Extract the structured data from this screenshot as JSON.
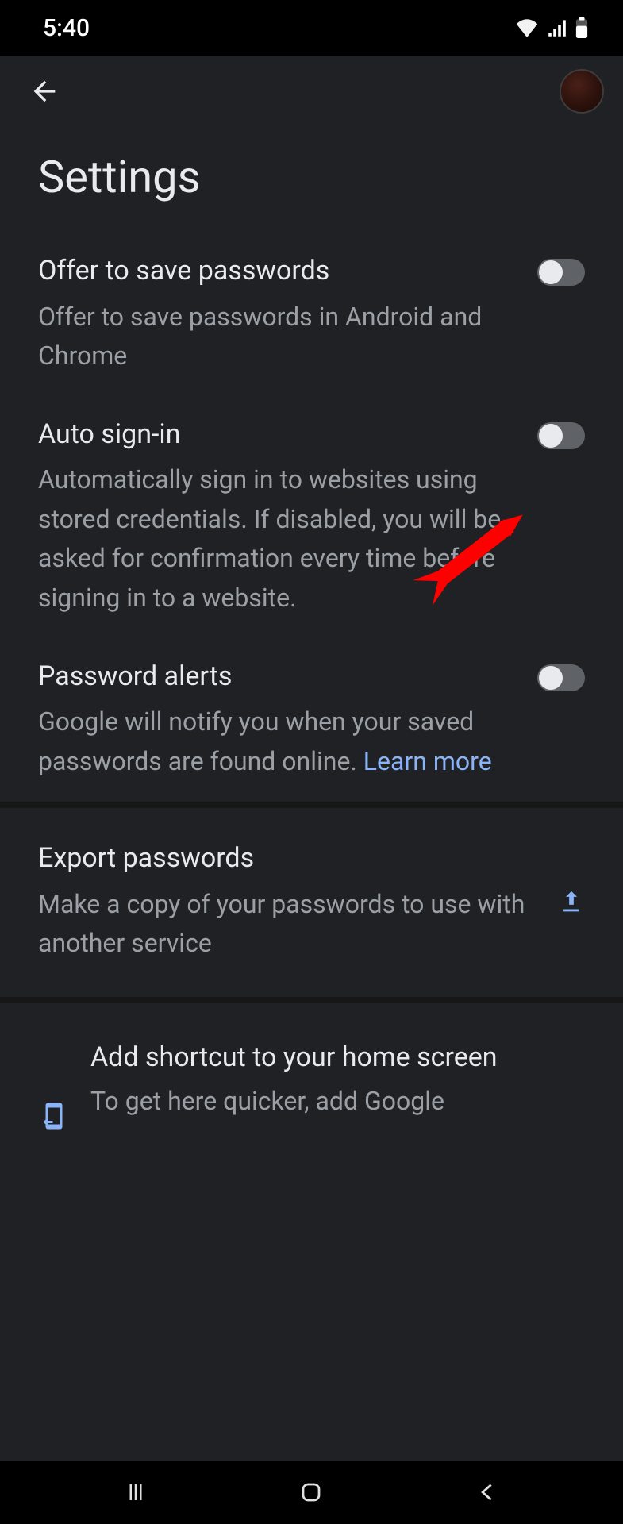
{
  "status_bar": {
    "time": "5:40"
  },
  "app_bar": {},
  "page_title": "Settings",
  "rows": {
    "offer_save": {
      "title": "Offer to save passwords",
      "desc": "Offer to save passwords in Android and Chrome",
      "on": false
    },
    "auto_signin": {
      "title": "Auto sign-in",
      "desc": "Automatically sign in to websites using stored credentials. If disabled, you will be asked for confirmation every time before signing in to a website.",
      "on": false
    },
    "pw_alerts": {
      "title": "Password alerts",
      "desc_pre": "Google will notify you when your saved passwords are found online. ",
      "link": "Learn more",
      "on": false
    },
    "export": {
      "title": "Export passwords",
      "desc": "Make a copy of your passwords to use with another service"
    },
    "shortcut": {
      "title": "Add shortcut to your home screen",
      "desc": "To get here quicker, add Google"
    }
  }
}
